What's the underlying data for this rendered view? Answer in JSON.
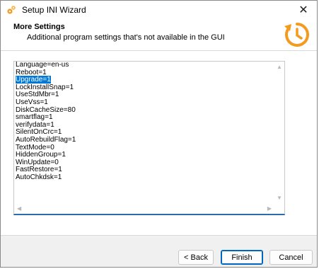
{
  "window": {
    "title": "Setup INI Wizard",
    "close_label": "✕"
  },
  "header": {
    "title": "More Settings",
    "subtitle": "Additional program settings that's not available in the GUI"
  },
  "editor": {
    "lines": [
      "Language=en-us",
      "Reboot=1",
      "Upgrade=1",
      "LockInstallSnap=1",
      "UseStdMbr=1",
      "UseVss=1",
      "DiskCacheSize=80",
      "smartflag=1",
      "verifydata=1",
      "SilentOnCrc=1",
      "AutoRebuildFlag=1",
      "TextMode=0",
      "HiddenGroup=1",
      "WinUpdate=0",
      "FastRestore=1",
      "AutoChkdsk=1"
    ],
    "selected_line_index": 2
  },
  "buttons": {
    "back": "< Back",
    "finish": "Finish",
    "cancel": "Cancel"
  },
  "colors": {
    "accent": "#0078d7",
    "logo": "#f39a1f"
  }
}
